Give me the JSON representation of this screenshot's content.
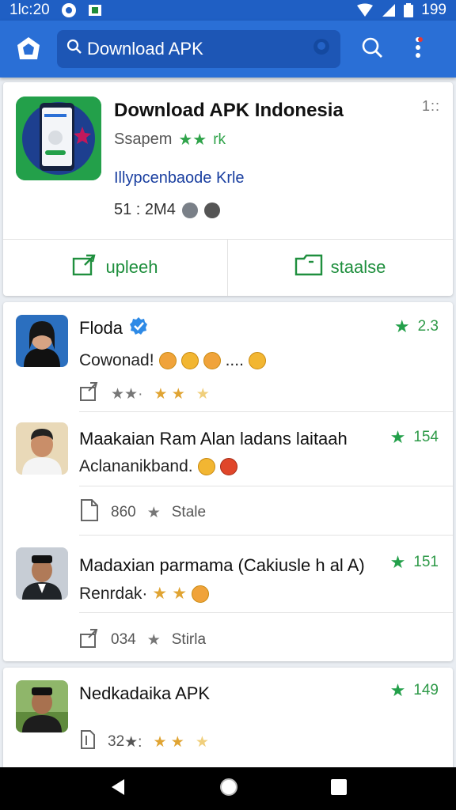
{
  "status_bar": {
    "time": "1lc:20",
    "battery": "199"
  },
  "app_bar": {
    "search_text": "Download APK"
  },
  "app_card": {
    "title": "Download APK Indonesia",
    "more": "1::",
    "developer": "Ssapem",
    "stars": "★★",
    "rating_suffix": "rk",
    "category": "Illypcenbaode Krle",
    "meta": "51 : 2M4",
    "action_left_label": "upleeh",
    "action_right_label": "staalse"
  },
  "reviews": [
    {
      "name": "Floda",
      "verified": true,
      "rating": "2.3",
      "text": "Cowonad!",
      "text_suffix": "....",
      "actions_stars": "★★·",
      "actions_gold": "★ ★",
      "actions_light": "★"
    },
    {
      "name": "Maakaian Ram Alan ladans laitaah",
      "rating": "154",
      "text": "Aclananikband.",
      "count": "860",
      "label": "Stale"
    },
    {
      "name": "Madaxian parmama (Cakiusle h al A)",
      "rating": "151",
      "text": "Renrdak·",
      "count": "034",
      "label": "Stirla"
    },
    {
      "name": "Nedkadaika APK",
      "rating": "149",
      "count": "32",
      "count_suffix": "★:",
      "stars_gold": "★ ★",
      "star_light": "★"
    }
  ],
  "colors": {
    "primary": "#2a6fd6",
    "status": "#1f5fc4",
    "green": "#23a04a",
    "gold": "#e0a433"
  }
}
